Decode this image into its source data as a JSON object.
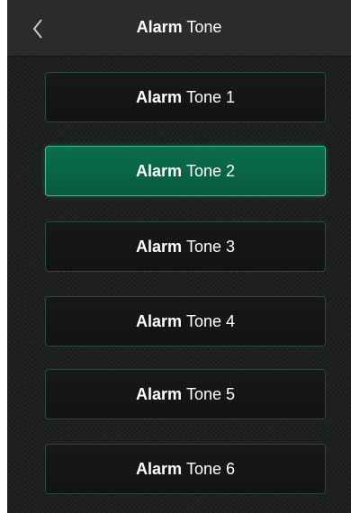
{
  "header": {
    "back_icon": "chevron-left-icon",
    "title_bold": "Alarm",
    "title_rest": "Tone"
  },
  "tones": [
    {
      "bold": "Alarm",
      "rest": "Tone 1",
      "selected": false
    },
    {
      "bold": "Alarm",
      "rest": "Tone 2",
      "selected": true
    },
    {
      "bold": "Alarm",
      "rest": "Tone 3",
      "selected": false
    },
    {
      "bold": "Alarm",
      "rest": "Tone 4",
      "selected": false
    },
    {
      "bold": "Alarm",
      "rest": "Tone 5",
      "selected": false
    },
    {
      "bold": "Alarm",
      "rest": "Tone 6",
      "selected": false
    }
  ],
  "colors": {
    "background": "#1f2020",
    "header": "#2a2b2b",
    "selected": "#0b6e4f",
    "border": "#254a3e"
  }
}
